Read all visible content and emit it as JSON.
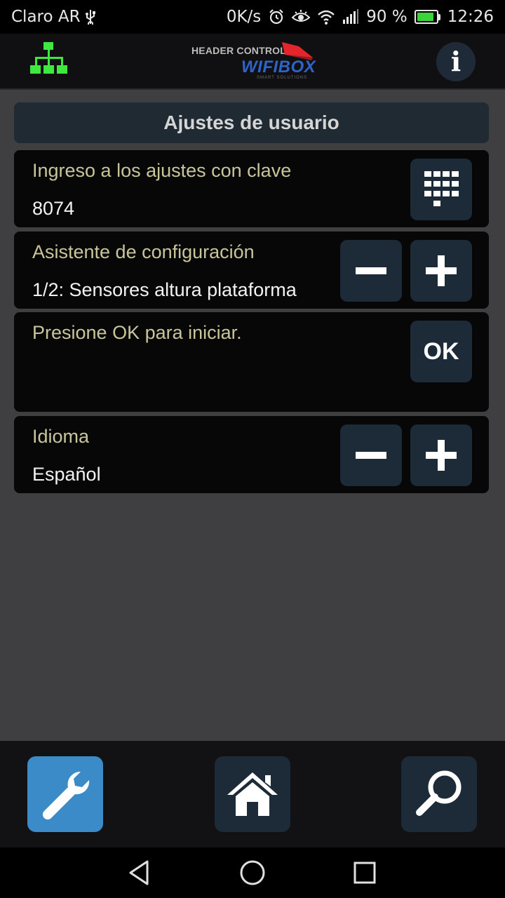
{
  "status_bar": {
    "carrier": "Claro AR",
    "speed": "0K/s",
    "battery": "90 %",
    "battery_level": 0.9,
    "time": "12:26",
    "icons": [
      "usb-icon",
      "alarm-icon",
      "eye-icon",
      "wifi-icon",
      "signal-icon",
      "battery-icon"
    ]
  },
  "header": {
    "logo_header": "HEADER CONTROL",
    "logo_brand": "WIFIBOX",
    "logo_tagline": "smart solutions",
    "left_icon": "network-icon",
    "right_icon": "info-icon",
    "info_glyph": "i"
  },
  "title": "Ajustes de usuario",
  "settings": {
    "password": {
      "label": "Ingreso a los ajustes con clave",
      "value": "8074",
      "button_icon": "keypad-icon"
    },
    "wizard": {
      "label": "Asistente de configuración",
      "value": "1/2: Sensores altura plataforma",
      "minus_icon": "minus-icon",
      "plus_icon": "plus-icon"
    },
    "start": {
      "label": "Presione OK para iniciar.",
      "button_label": "OK"
    },
    "language": {
      "label": "Idioma",
      "value": "Español",
      "minus_icon": "minus-icon",
      "plus_icon": "plus-icon"
    }
  },
  "bottom_nav": {
    "items": [
      {
        "icon": "wrench-icon",
        "active": true
      },
      {
        "icon": "home-icon",
        "active": false
      },
      {
        "icon": "search-icon",
        "active": false
      }
    ]
  },
  "system_nav": [
    "back-icon",
    "home-circle-icon",
    "recents-icon"
  ],
  "colors": {
    "background": "#3f3f41",
    "card": "#070708",
    "button": "#1d2a38",
    "active_nav": "#3a8bc8",
    "label": "#c9c59a",
    "network_green": "#3ee83e"
  }
}
